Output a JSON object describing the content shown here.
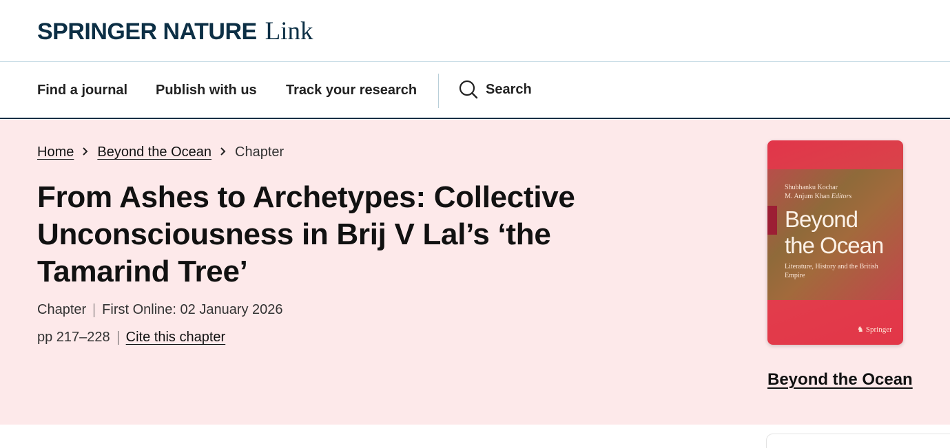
{
  "brand": {
    "name": "SPRINGER NATURE",
    "product": "Link"
  },
  "nav": {
    "items": [
      "Find a journal",
      "Publish with us",
      "Track your research"
    ],
    "search_label": "Search",
    "search_icon": "search-icon"
  },
  "breadcrumb": {
    "home": "Home",
    "book": "Beyond the Ocean",
    "current": "Chapter"
  },
  "chapter": {
    "title": "From Ashes to Archetypes: Collective Unconsciousness in Brij V Lal’s ‘the Tamarind Tree’",
    "type": "Chapter",
    "first_online": "First Online: 02 January 2026",
    "pages": "pp 217–228",
    "cite_label": "Cite this chapter"
  },
  "book": {
    "cover_editor_1": "Shubhanku Kochar",
    "cover_editor_2": "M. Anjum Khan",
    "cover_editors_label": "Editors",
    "cover_title_line1": "Beyond",
    "cover_title_line2": "the Ocean",
    "cover_subtitle": "Literature, History and the British Empire",
    "cover_publisher": "Springer",
    "link_label": "Beyond the Ocean"
  },
  "colors": {
    "brand": "#0c2f45",
    "hero_bg": "#fde9ea",
    "cover_red": "#e2354a"
  }
}
